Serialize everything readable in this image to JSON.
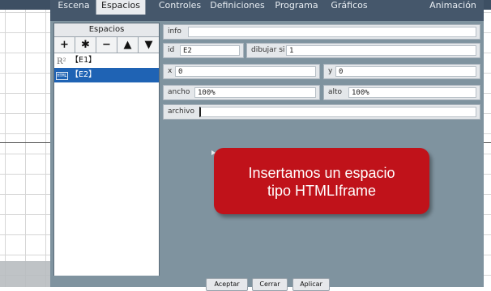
{
  "tabs": [
    {
      "label": "Escena"
    },
    {
      "label": "Espacios"
    },
    {
      "label": "Controles"
    },
    {
      "label": "Definiciones"
    },
    {
      "label": "Programa"
    },
    {
      "label": "Gráficos"
    },
    {
      "label": "Animación"
    }
  ],
  "spaces": {
    "title": "Espacios",
    "tools": [
      "+",
      "✱",
      "−",
      "▲",
      "▼"
    ],
    "items": [
      {
        "label": "【E1】",
        "icon": "R²"
      },
      {
        "label": "【E2】",
        "icon": "HTML",
        "selected": true
      }
    ]
  },
  "props": {
    "info": {
      "label": "info",
      "value": ""
    },
    "id": {
      "label": "id",
      "value": "E2"
    },
    "drawif": {
      "label": "dibujar si",
      "value": "1"
    },
    "x": {
      "label": "x",
      "value": "0"
    },
    "y": {
      "label": "y",
      "value": "0"
    },
    "width": {
      "label": "ancho",
      "value": "100%"
    },
    "height": {
      "label": "alto",
      "value": "100%"
    },
    "file": {
      "label": "archivo",
      "value": ""
    }
  },
  "tooltip": {
    "line1": "Insertamos un espacio",
    "line2": "tipo HTMLIframe"
  },
  "buttons": {
    "accept": "Aceptar",
    "close": "Cerrar",
    "apply": "Aplicar"
  }
}
